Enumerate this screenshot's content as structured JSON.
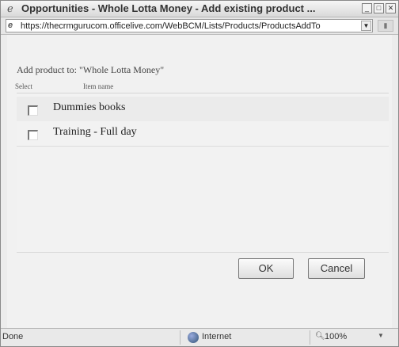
{
  "window": {
    "title": "Opportunities - Whole Lotta Money - Add existing product ...",
    "title_icon": "ie-page-icon",
    "controls": [
      "minimize",
      "maximize",
      "close"
    ]
  },
  "address_bar": {
    "url": "https://thecrmgurucom.officelive.com/WebBCM/Lists/Products/ProductsAddTo"
  },
  "dialog": {
    "add_to_label": "Add product to: \"Whole Lotta Money\"",
    "columns": {
      "select": "Select",
      "item_name": "Item name"
    },
    "items": [
      {
        "name": "Dummies books",
        "checked": false
      },
      {
        "name": "Training - Full day",
        "checked": false
      }
    ],
    "ok_label": "OK",
    "cancel_label": "Cancel"
  },
  "status_bar": {
    "status": "Done",
    "zone": "Internet",
    "zoom": "100%"
  }
}
